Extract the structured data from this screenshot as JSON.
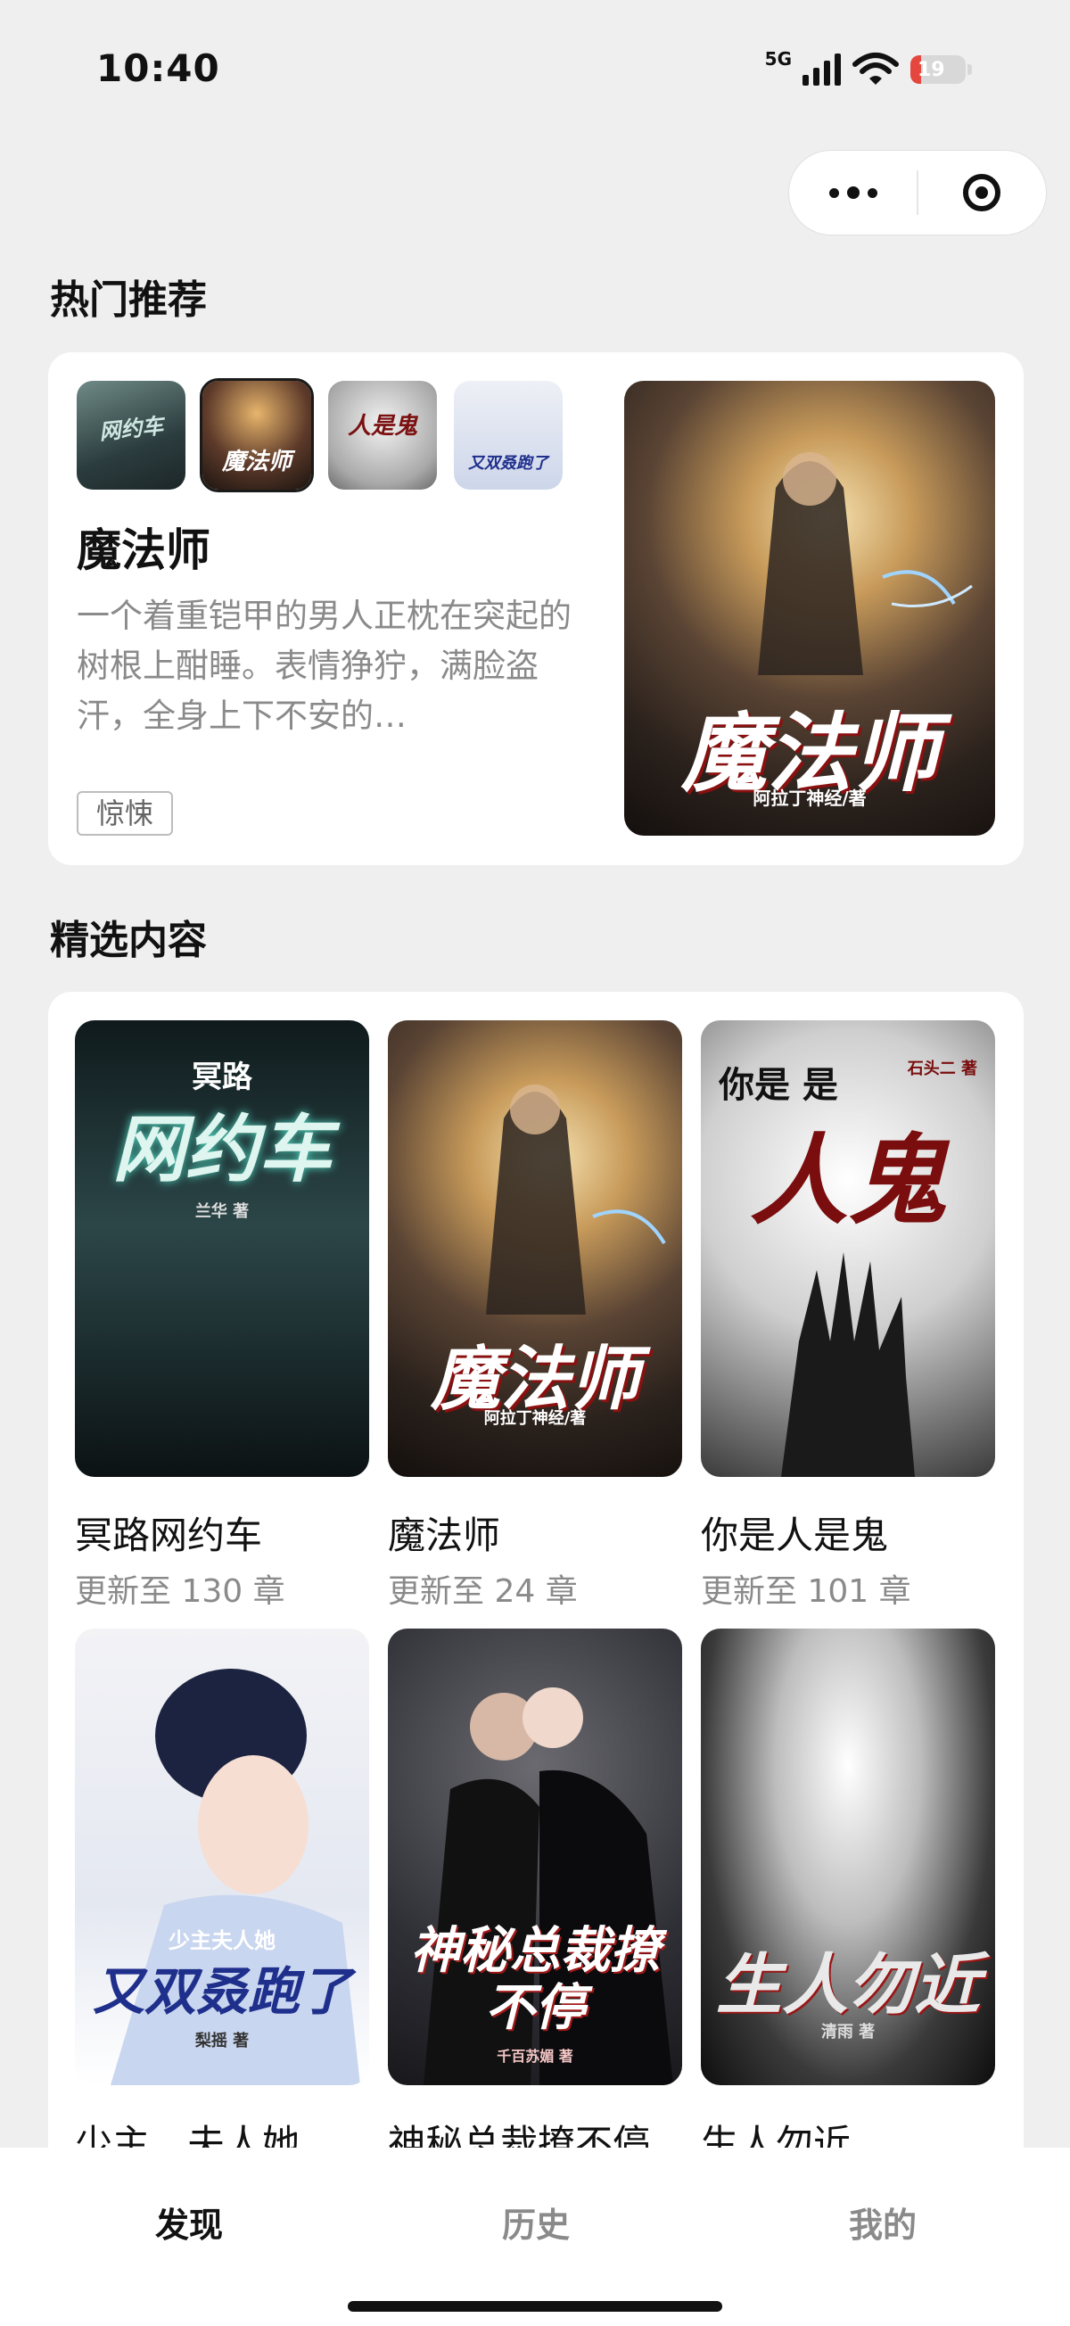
{
  "status_bar": {
    "time": "10:40",
    "network": "5G",
    "battery": "19",
    "battery_level": 0.19,
    "battery_color": "#e5463d"
  },
  "capsule": {
    "more_icon": "more-dots-icon",
    "close_icon": "target-close-icon"
  },
  "hot": {
    "section_title": "热门推荐",
    "thumbs": [
      {
        "text": "网约车"
      },
      {
        "text": "魔法师"
      },
      {
        "text": "人是鬼"
      },
      {
        "text": "又双叒跑了"
      }
    ],
    "title": "魔法师",
    "description": "一个着重铠甲的男人正枕在突起的树根上酣睡。表情狰狞，满脸盗汗，全身上下不安的…",
    "tag": "惊悚",
    "cover_title": "魔法师",
    "cover_author": "阿拉丁神经/著"
  },
  "featured": {
    "section_title": "精选内容",
    "books": [
      {
        "title": "冥路网约车",
        "subtitle": "更新至 130 章",
        "cover_small": "冥路",
        "cover_big": "网约车",
        "cover_author": "兰华 著"
      },
      {
        "title": "魔法师",
        "subtitle": "更新至 24 章",
        "cover_small": "",
        "cover_big": "魔法师",
        "cover_author": "阿拉丁神经/著"
      },
      {
        "title": "你是人是鬼",
        "subtitle": "更新至 101 章",
        "cover_small": "你是 是",
        "cover_big": "人鬼",
        "cover_author": "石头二 著"
      },
      {
        "title": "少主，夫人她",
        "subtitle": "",
        "cover_small": "少主夫人她",
        "cover_big": "又双叒跑了",
        "cover_author": "梨摇 著"
      },
      {
        "title": "神秘总裁撩不停",
        "subtitle": "",
        "cover_small": "",
        "cover_big": "神秘总裁撩不停",
        "cover_author": "千百苏媚 著"
      },
      {
        "title": "生人勿近",
        "subtitle": "",
        "cover_small": "",
        "cover_big": "生人勿近",
        "cover_author": "清雨 著"
      }
    ]
  },
  "tabs": [
    {
      "label": "发现",
      "color": "#111111"
    },
    {
      "label": "历史",
      "color": "#8a8a8a"
    },
    {
      "label": "我的",
      "color": "#8a8a8a"
    }
  ]
}
